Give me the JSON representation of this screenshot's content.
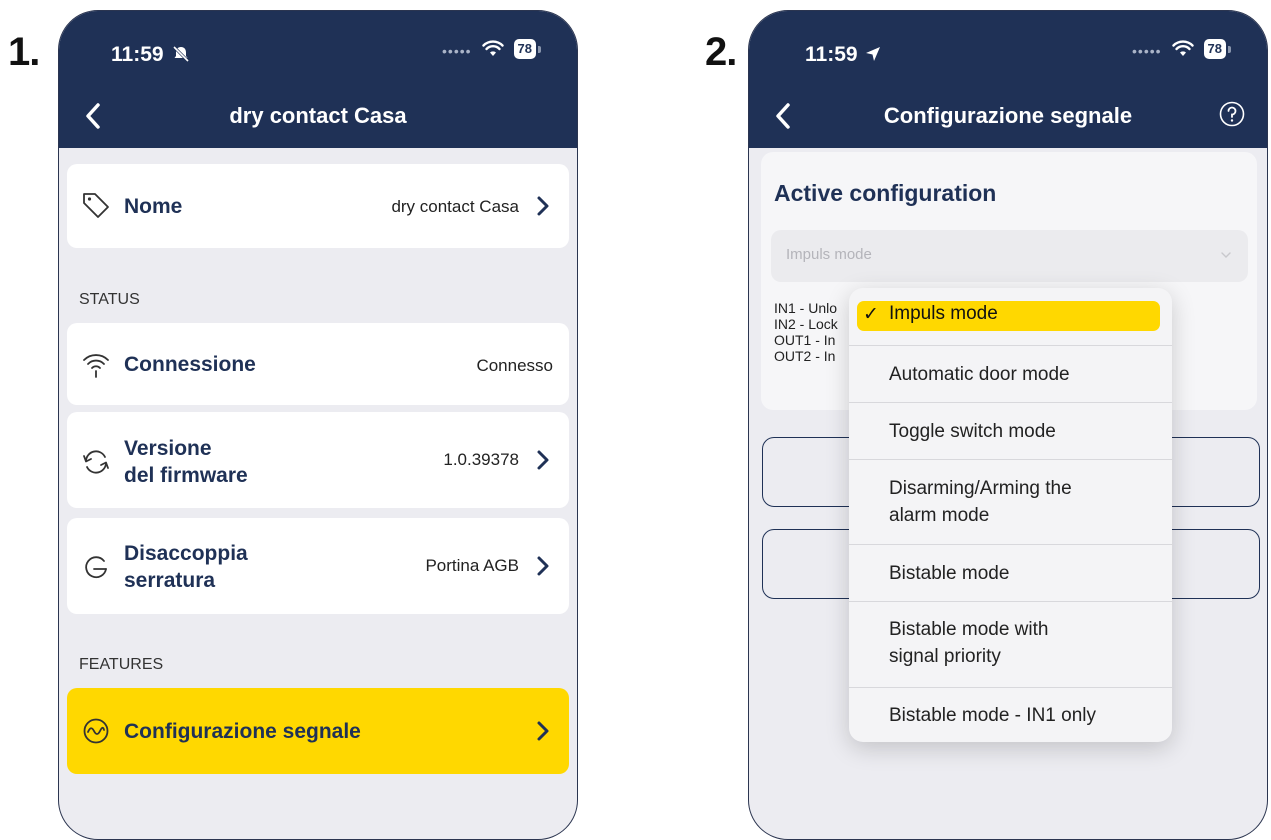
{
  "steps": {
    "one": "1.",
    "two": "2."
  },
  "colors": {
    "navy": "#1f3156",
    "accent_yellow": "#ffd800",
    "background": "#ececf1"
  },
  "phone1": {
    "status": {
      "time": "11:59",
      "time_icon": "bell-slash-icon",
      "battery": "78"
    },
    "nav": {
      "title": "dry contact Casa",
      "back_icon": "chevron-left-icon"
    },
    "nome": {
      "icon": "tag-icon",
      "label": "Nome",
      "value": "dry contact Casa"
    },
    "status_section": "STATUS",
    "connessione": {
      "icon": "wifi-icon",
      "label": "Connessione",
      "value": "Connesso"
    },
    "firmware": {
      "icon": "sync-icon",
      "label_line1": "Versione",
      "label_line2": "del firmware",
      "value": "1.0.39378"
    },
    "disaccoppia": {
      "icon": "lock-cycle-icon",
      "label_line1": "Disaccoppia",
      "label_line2": "serratura",
      "value": "Portina AGB"
    },
    "features_section": "FEATURES",
    "configurazione": {
      "icon": "signal-wave-icon",
      "label": "Configurazione segnale"
    }
  },
  "phone2": {
    "status": {
      "time": "11:59",
      "time_icon": "location-arrow-icon",
      "battery": "78"
    },
    "nav": {
      "title": "Configurazione segnale",
      "back_icon": "chevron-left-icon",
      "help_icon": "question-circle-icon"
    },
    "config": {
      "title": "Active configuration",
      "select_value": "Impuls mode",
      "io_lines": [
        "IN1 - Unlo",
        "IN2 - Lock",
        "OUT1 - In",
        "OUT2 - In"
      ]
    },
    "dropdown": {
      "selected": "Impuls mode",
      "check": "✓",
      "options": [
        "Impuls mode",
        "Automatic door mode",
        "Toggle switch mode",
        "Disarming/Arming the",
        "alarm mode",
        "Bistable mode",
        "Bistable mode with",
        "signal priority",
        "Bistable mode - IN1 only"
      ]
    }
  }
}
